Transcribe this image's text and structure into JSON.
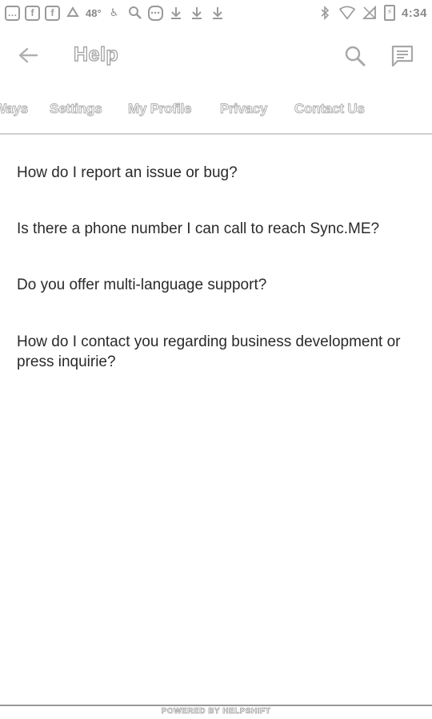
{
  "status_bar": {
    "temperature": "48°",
    "time": "4:34",
    "left_icons": [
      "chat-bubble-icon",
      "facebook-icon",
      "facebook-icon",
      "recycle-icon",
      "temperature-icon",
      "wheelchair-icon",
      "wrench-icon",
      "messenger-icon",
      "download-icon",
      "download-icon",
      "download-icon"
    ],
    "right_icons": [
      "bluetooth-icon",
      "wifi-icon",
      "no-sim-icon",
      "battery-icon"
    ]
  },
  "app_bar": {
    "title": "Help",
    "back_icon": "arrow-left-icon",
    "search_icon": "search-icon",
    "feedback_icon": "feedback-icon"
  },
  "tabs": [
    {
      "label": "Ways"
    },
    {
      "label": "Settings"
    },
    {
      "label": "My Profile"
    },
    {
      "label": "Privacy"
    },
    {
      "label": "Contact Us"
    }
  ],
  "questions": [
    {
      "text": "How do I report an issue or bug?"
    },
    {
      "text": "Is there a phone number I can call to reach Sync.ME?"
    },
    {
      "text": "Do you offer multi-language support?"
    },
    {
      "text": "How do I contact you regarding business development or press inquirie?"
    }
  ],
  "footer": {
    "text": "POWERED BY HELPSHIFT"
  },
  "colors": {
    "icon_gray": "#9a9a9a",
    "text_dark": "#2a2a2a",
    "divider": "#cfcfcf",
    "background": "#ffffff"
  }
}
